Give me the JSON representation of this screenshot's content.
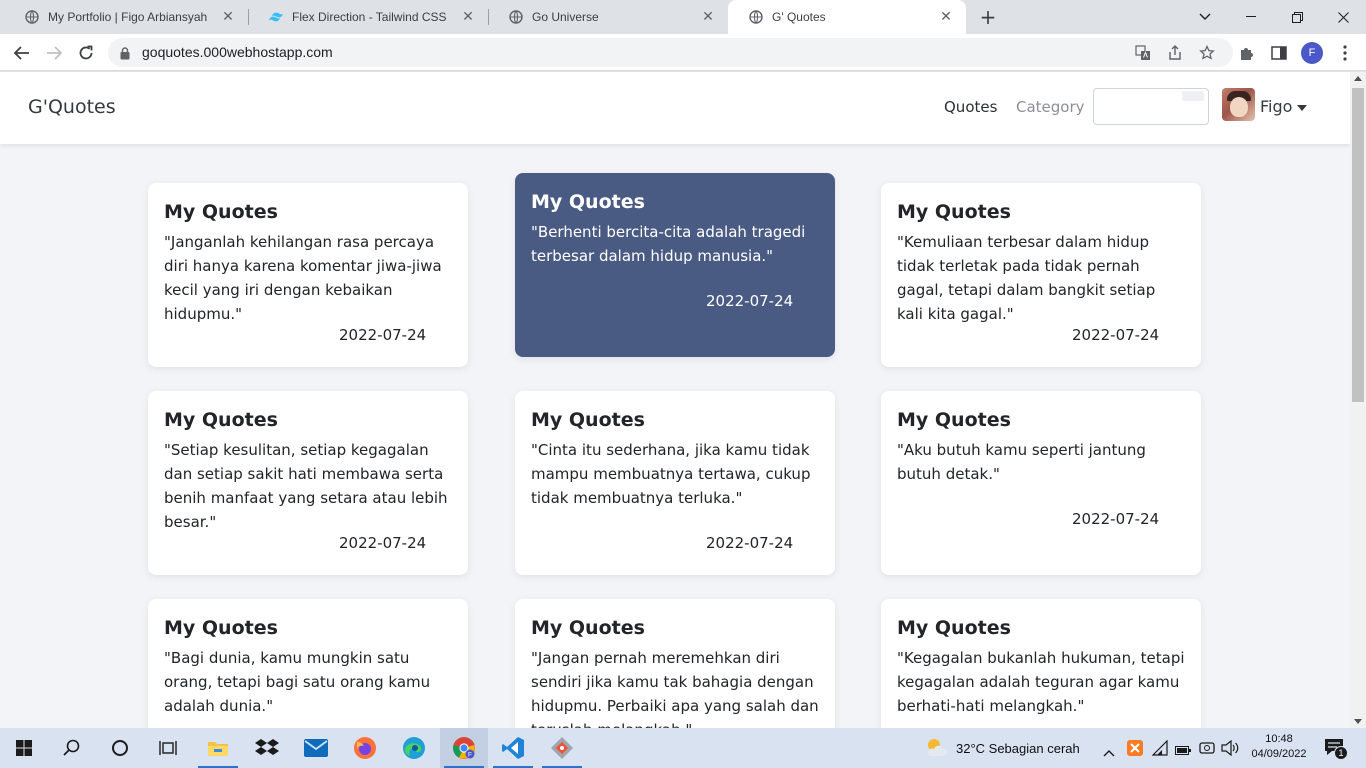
{
  "browser": {
    "tabs": [
      {
        "title": "My Portfolio | Figo Arbiansyah",
        "favicon": "globe-icon",
        "active": false
      },
      {
        "title": "Flex Direction - Tailwind CSS",
        "favicon": "tailwind-icon",
        "active": false
      },
      {
        "title": "Go Universe",
        "favicon": "globe-icon",
        "active": false
      },
      {
        "title": "G' Quotes",
        "favicon": "globe-icon",
        "active": true
      }
    ],
    "new_tab_label": "+",
    "url": "goquotes.000webhostapp.com",
    "profile_initial": "F"
  },
  "site": {
    "brand": "G'Quotes",
    "nav": {
      "quotes": "Quotes",
      "category": "Category"
    },
    "search_value": "",
    "user_name": "Figo"
  },
  "quotes": [
    {
      "title": "My Quotes",
      "text": "\"Janganlah kehilangan rasa percaya diri hanya karena komentar jiwa-jiwa kecil yang iri dengan kebaikan hidupmu.\"",
      "date": "2022-07-24"
    },
    {
      "title": "My Quotes",
      "text": "\"Berhenti bercita-cita adalah tragedi terbesar dalam hidup manusia.\"",
      "date": "2022-07-24"
    },
    {
      "title": "My Quotes",
      "text": "\"Kemuliaan terbesar dalam hidup tidak terletak pada tidak pernah gagal, tetapi dalam bangkit setiap kali kita gagal.\"",
      "date": "2022-07-24"
    },
    {
      "title": "My Quotes",
      "text": "\"Setiap kesulitan, setiap kegagalan dan setiap sakit hati membawa serta benih manfaat yang setara atau lebih besar.\"",
      "date": "2022-07-24"
    },
    {
      "title": "My Quotes",
      "text": "\"Cinta itu sederhana, jika kamu tidak mampu membuatnya tertawa, cukup tidak membuatnya terluka.\"",
      "date": "2022-07-24"
    },
    {
      "title": "My Quotes",
      "text": "\"Aku butuh kamu seperti jantung butuh detak.\"",
      "date": "2022-07-24"
    },
    {
      "title": "My Quotes",
      "text": "\"Bagi dunia, kamu mungkin satu orang, tetapi bagi satu orang kamu adalah dunia.\"",
      "date": ""
    },
    {
      "title": "My Quotes",
      "text": "\"Jangan pernah meremehkan diri sendiri jika kamu tak bahagia dengan hidupmu. Perbaiki apa yang salah dan teruslah melangkah.\"",
      "date": ""
    },
    {
      "title": "My Quotes",
      "text": "\"Kegagalan bukanlah hukuman, tetapi kegagalan adalah teguran agar kamu berhati-hati melangkah.\"",
      "date": ""
    }
  ],
  "taskbar": {
    "weather": "32°C  Sebagian cerah",
    "time": "10:48",
    "date": "04/09/2022",
    "notification_count": "1"
  },
  "colors": {
    "featured_card": "#4a5b83",
    "page_bg": "#f3f4f7",
    "accent_blue": "#2a72d0"
  }
}
